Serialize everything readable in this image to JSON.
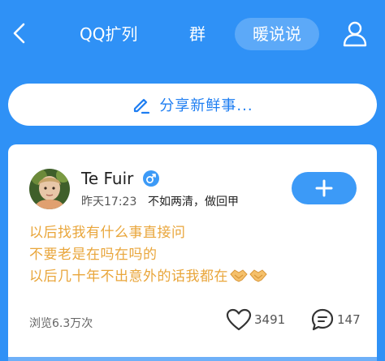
{
  "header": {
    "tabs": [
      {
        "label": "QQ扩列"
      },
      {
        "label": "群"
      },
      {
        "label": "暖说说",
        "active": true
      }
    ]
  },
  "share": {
    "label": "分享新鲜事..."
  },
  "post": {
    "username": "Te Fuir",
    "gender": "male",
    "time": "昨天17:23",
    "tag": "不如两清，做回甲",
    "lines": [
      "以后找我有什么事直接问",
      "不要老是在吗在吗的",
      "以后几十年不出意外的话我都在"
    ],
    "emoji": [
      "handshake",
      "handshake"
    ],
    "views": "浏览6.3万次",
    "likes": "3491",
    "comments": "147"
  },
  "colors": {
    "background": "#2f91f6",
    "accent": "#3c9af7",
    "text_highlight": "#e9a63b"
  },
  "icons": [
    "back-arrow-icon",
    "profile-icon",
    "pencil-icon",
    "male-icon",
    "plus-icon",
    "heart-icon",
    "comment-icon",
    "handshake-icon"
  ]
}
